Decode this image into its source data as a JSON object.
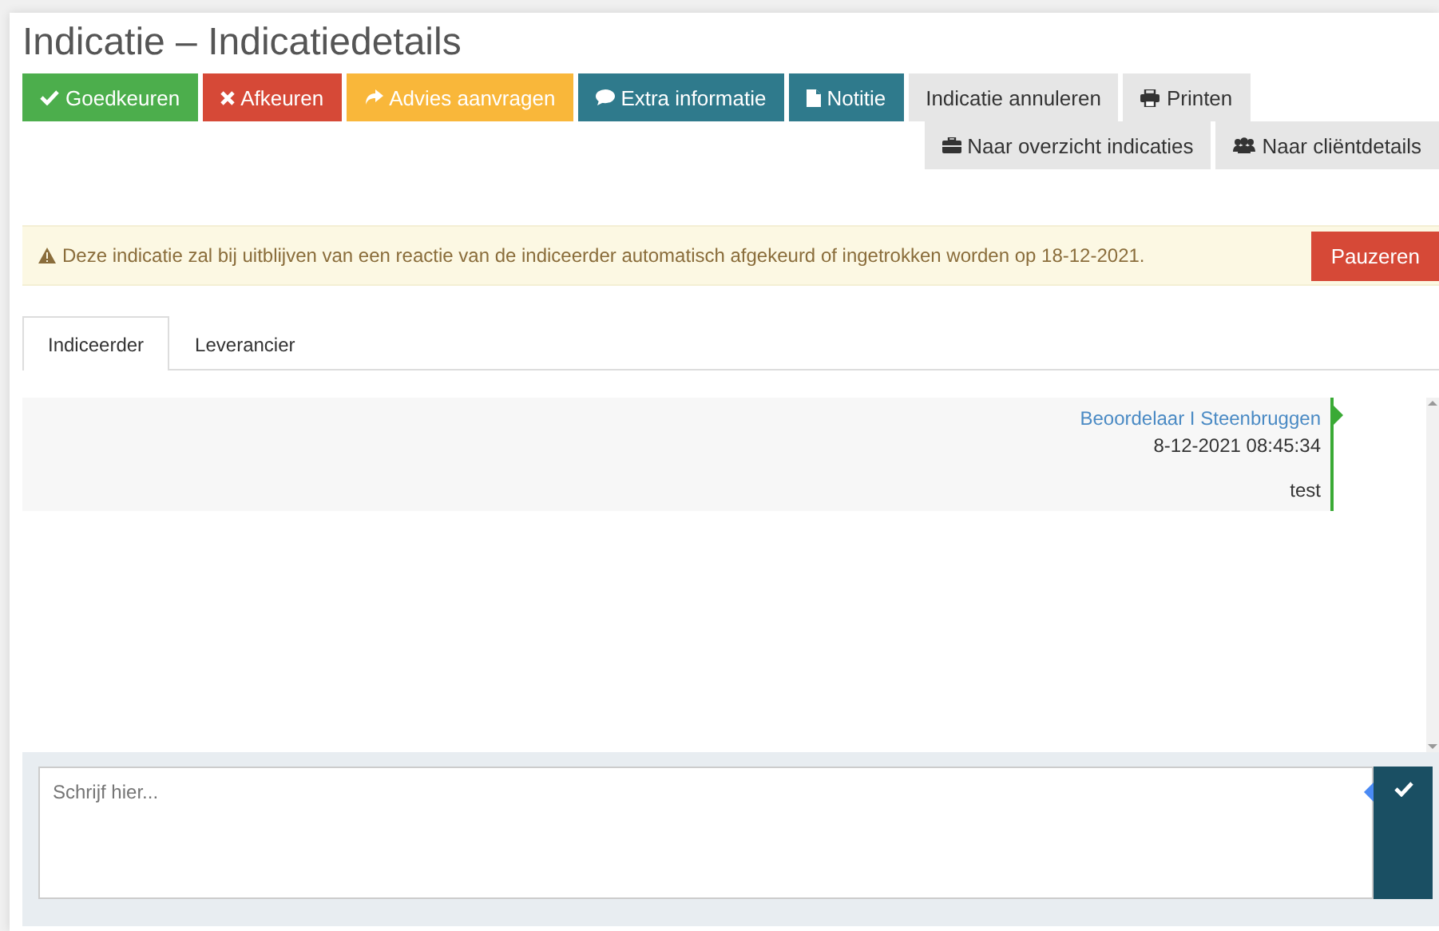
{
  "title": "Indicatie – Indicatiedetails",
  "actions": [
    {
      "label": "Goedkeuren",
      "kind": "success"
    },
    {
      "label": "Afkeuren",
      "kind": "danger"
    },
    {
      "label": "Advies aanvragen",
      "kind": "warning"
    },
    {
      "label": "Extra informatie",
      "kind": "info"
    },
    {
      "label": "Notitie",
      "kind": "info"
    },
    {
      "label": "Indicatie annuleren",
      "kind": "default"
    },
    {
      "label": "Printen",
      "kind": "default"
    }
  ],
  "navigation": [
    {
      "label": "Naar overzicht indicaties"
    },
    {
      "label": "Naar cliëntdetails"
    }
  ],
  "alert": {
    "text": "Deze indicatie zal bij uitblijven van een reactie van de indiceerder automatisch afgekeurd of ingetrokken worden op 18-12-2021.",
    "button": "Pauzeren"
  },
  "tabs": [
    {
      "label": "Indiceerder",
      "selected": true
    },
    {
      "label": "Leverancier",
      "selected": false
    }
  ],
  "messages": [
    {
      "author": "Beoordelaar I Steenbruggen",
      "time": "8-12-2021 08:45:34",
      "text": "test"
    }
  ],
  "composer": {
    "placeholder": "Schrijf hier..."
  }
}
